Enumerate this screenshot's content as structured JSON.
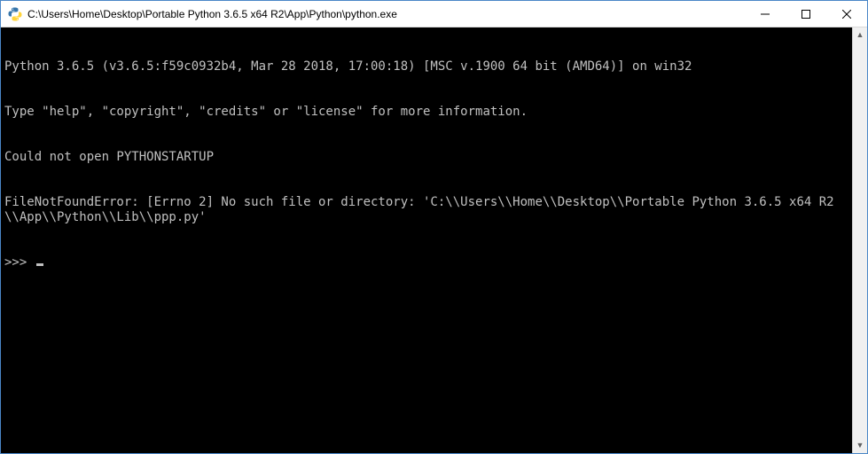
{
  "window": {
    "title": "C:\\Users\\Home\\Desktop\\Portable Python 3.6.5 x64 R2\\App\\Python\\python.exe"
  },
  "console": {
    "lines": [
      "Python 3.6.5 (v3.6.5:f59c0932b4, Mar 28 2018, 17:00:18) [MSC v.1900 64 bit (AMD64)] on win32",
      "Type \"help\", \"copyright\", \"credits\" or \"license\" for more information.",
      "Could not open PYTHONSTARTUP",
      "FileNotFoundError: [Errno 2] No such file or directory: 'C:\\\\Users\\\\Home\\\\Desktop\\\\Portable Python 3.6.5 x64 R2\\\\App\\\\Python\\\\Lib\\\\ppp.py'"
    ],
    "prompt": ">>> "
  },
  "icons": {
    "minimize": "minimize",
    "maximize": "maximize",
    "close": "close",
    "scroll_up": "▲",
    "scroll_down": "▼"
  }
}
